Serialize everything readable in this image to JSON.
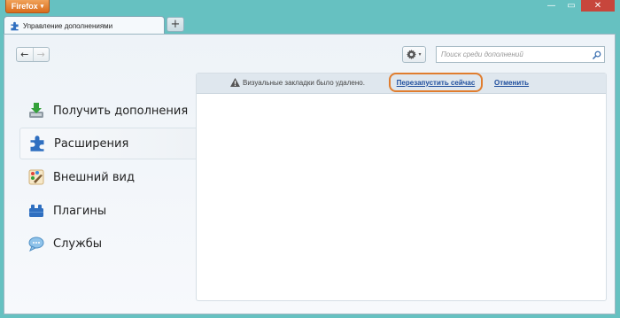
{
  "window": {
    "menu_button_label": "Firefox",
    "menu_button_arrow": "▾",
    "minimize_glyph": "—",
    "maximize_glyph": "▭",
    "close_glyph": "✕"
  },
  "tabs": [
    {
      "label": "Управление дополнениями",
      "icon": "puzzle-piece-icon"
    }
  ],
  "new_tab_label": "+",
  "toolbar": {
    "back_glyph": "←",
    "forward_glyph": "→",
    "gear_dropdown_glyph": "▾",
    "search_placeholder": "Поиск среди дополнений",
    "search_value": ""
  },
  "sidebar": {
    "items": [
      {
        "label": "Получить дополнения",
        "icon": "download-addons-icon",
        "selected": false
      },
      {
        "label": "Расширения",
        "icon": "puzzle-piece-icon",
        "selected": true
      },
      {
        "label": "Внешний вид",
        "icon": "appearance-brush-icon",
        "selected": false
      },
      {
        "label": "Плагины",
        "icon": "plugin-block-icon",
        "selected": false
      },
      {
        "label": "Службы",
        "icon": "services-chat-icon",
        "selected": false
      }
    ]
  },
  "notification": {
    "message": "Визуальные закладки было удалено.",
    "restart_link": "Перезапустить сейчас",
    "undo_link": "Отменить"
  },
  "colors": {
    "window_frame": "#66c1c1",
    "firefox_button": "#e0802e",
    "close_button": "#c7463c",
    "highlight_ring": "#e07d2e",
    "link": "#1f4e9d"
  }
}
